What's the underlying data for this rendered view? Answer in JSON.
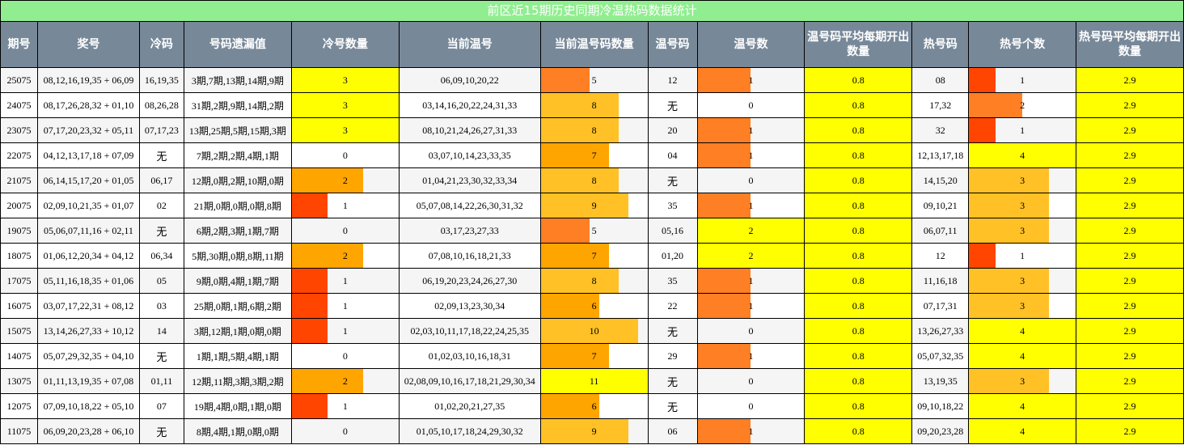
{
  "title": "前区近15期历史同期冷温热码数据统计",
  "headers": [
    "期号",
    "奖号",
    "冷码",
    "号码遗漏值",
    "冷号数量",
    "当前温号",
    "当前温号码数量",
    "温号码",
    "温号数",
    "温号码平均每期开出数量",
    "热号码",
    "热号个数",
    "热号码平均每期开出数量"
  ],
  "none_label": "无",
  "colors": {
    "title_bg": "#90ee90",
    "header_bg": "#778899",
    "yellow": "#ffff00",
    "bar_1": "#ff4500",
    "bar_2": "#ffa500",
    "bar_3": "#ffc125",
    "warm_bar": "#ff7f24"
  },
  "chart_data": {
    "type": "table",
    "scales": {
      "cold_count_max": 3,
      "warm_current_max": 11,
      "warm_count_max": 2,
      "hot_count_max": 4
    },
    "rows": [
      {
        "issue": "25075",
        "draw": "08,12,16,19,35 + 06,09",
        "cold_codes": "16,19,35",
        "miss": "3期,7期,13期,14期,9期",
        "cold_count": 3,
        "warm_current": "06,09,10,20,22",
        "warm_current_count": 5,
        "warm_codes": "12",
        "warm_count": 1,
        "warm_avg": "0.8",
        "hot_codes": "08",
        "hot_count": 1,
        "hot_avg": "2.9"
      },
      {
        "issue": "24075",
        "draw": "08,17,26,28,32 + 01,10",
        "cold_codes": "08,26,28",
        "miss": "31期,2期,9期,14期,2期",
        "cold_count": 3,
        "warm_current": "03,14,16,20,22,24,31,33",
        "warm_current_count": 8,
        "warm_codes": "无",
        "warm_count": 0,
        "warm_avg": "0.8",
        "hot_codes": "17,32",
        "hot_count": 2,
        "hot_avg": "2.9"
      },
      {
        "issue": "23075",
        "draw": "07,17,20,23,32 + 05,11",
        "cold_codes": "07,17,23",
        "miss": "13期,25期,5期,15期,3期",
        "cold_count": 3,
        "warm_current": "08,10,21,24,26,27,31,33",
        "warm_current_count": 8,
        "warm_codes": "20",
        "warm_count": 1,
        "warm_avg": "0.8",
        "hot_codes": "32",
        "hot_count": 1,
        "hot_avg": "2.9"
      },
      {
        "issue": "22075",
        "draw": "04,12,13,17,18 + 07,09",
        "cold_codes": "无",
        "miss": "7期,2期,2期,4期,1期",
        "cold_count": 0,
        "warm_current": "03,07,10,14,23,33,35",
        "warm_current_count": 7,
        "warm_codes": "04",
        "warm_count": 1,
        "warm_avg": "0.8",
        "hot_codes": "12,13,17,18",
        "hot_count": 4,
        "hot_avg": "2.9"
      },
      {
        "issue": "21075",
        "draw": "06,14,15,17,20 + 01,05",
        "cold_codes": "06,17",
        "miss": "12期,0期,2期,10期,0期",
        "cold_count": 2,
        "warm_current": "01,04,21,23,30,32,33,34",
        "warm_current_count": 8,
        "warm_codes": "无",
        "warm_count": 0,
        "warm_avg": "0.8",
        "hot_codes": "14,15,20",
        "hot_count": 3,
        "hot_avg": "2.9"
      },
      {
        "issue": "20075",
        "draw": "02,09,10,21,35 + 01,07",
        "cold_codes": "02",
        "miss": "21期,0期,0期,0期,8期",
        "cold_count": 1,
        "warm_current": "05,07,08,14,22,26,30,31,32",
        "warm_current_count": 9,
        "warm_codes": "35",
        "warm_count": 1,
        "warm_avg": "0.8",
        "hot_codes": "09,10,21",
        "hot_count": 3,
        "hot_avg": "2.9"
      },
      {
        "issue": "19075",
        "draw": "05,06,07,11,16 + 02,11",
        "cold_codes": "无",
        "miss": "6期,2期,3期,1期,7期",
        "cold_count": 0,
        "warm_current": "03,17,23,27,33",
        "warm_current_count": 5,
        "warm_codes": "05,16",
        "warm_count": 2,
        "warm_avg": "0.8",
        "hot_codes": "06,07,11",
        "hot_count": 3,
        "hot_avg": "2.9"
      },
      {
        "issue": "18075",
        "draw": "01,06,12,20,34 + 04,12",
        "cold_codes": "06,34",
        "miss": "5期,30期,0期,8期,11期",
        "cold_count": 2,
        "warm_current": "07,08,10,16,18,21,33",
        "warm_current_count": 7,
        "warm_codes": "01,20",
        "warm_count": 2,
        "warm_avg": "0.8",
        "hot_codes": "12",
        "hot_count": 1,
        "hot_avg": "2.9"
      },
      {
        "issue": "17075",
        "draw": "05,11,16,18,35 + 01,06",
        "cold_codes": "05",
        "miss": "9期,0期,4期,1期,7期",
        "cold_count": 1,
        "warm_current": "06,19,20,23,24,26,27,30",
        "warm_current_count": 8,
        "warm_codes": "35",
        "warm_count": 1,
        "warm_avg": "0.8",
        "hot_codes": "11,16,18",
        "hot_count": 3,
        "hot_avg": "2.9"
      },
      {
        "issue": "16075",
        "draw": "03,07,17,22,31 + 08,12",
        "cold_codes": "03",
        "miss": "25期,0期,1期,6期,2期",
        "cold_count": 1,
        "warm_current": "02,09,13,23,30,34",
        "warm_current_count": 6,
        "warm_codes": "22",
        "warm_count": 1,
        "warm_avg": "0.8",
        "hot_codes": "07,17,31",
        "hot_count": 3,
        "hot_avg": "2.9"
      },
      {
        "issue": "15075",
        "draw": "13,14,26,27,33 + 10,12",
        "cold_codes": "14",
        "miss": "3期,12期,1期,0期,0期",
        "cold_count": 1,
        "warm_current": "02,03,10,11,17,18,22,24,25,35",
        "warm_current_count": 10,
        "warm_codes": "无",
        "warm_count": 0,
        "warm_avg": "0.8",
        "hot_codes": "13,26,27,33",
        "hot_count": 4,
        "hot_avg": "2.9"
      },
      {
        "issue": "14075",
        "draw": "05,07,29,32,35 + 04,10",
        "cold_codes": "无",
        "miss": "1期,1期,5期,4期,1期",
        "cold_count": 0,
        "warm_current": "01,02,03,10,16,18,31",
        "warm_current_count": 7,
        "warm_codes": "29",
        "warm_count": 1,
        "warm_avg": "0.8",
        "hot_codes": "05,07,32,35",
        "hot_count": 4,
        "hot_avg": "2.9"
      },
      {
        "issue": "13075",
        "draw": "01,11,13,19,35 + 07,08",
        "cold_codes": "01,11",
        "miss": "12期,11期,3期,3期,2期",
        "cold_count": 2,
        "warm_current": "02,08,09,10,16,17,18,21,29,30,34",
        "warm_current_count": 11,
        "warm_codes": "无",
        "warm_count": 0,
        "warm_avg": "0.8",
        "hot_codes": "13,19,35",
        "hot_count": 3,
        "hot_avg": "2.9"
      },
      {
        "issue": "12075",
        "draw": "07,09,10,18,22 + 05,10",
        "cold_codes": "07",
        "miss": "19期,4期,0期,1期,0期",
        "cold_count": 1,
        "warm_current": "01,02,20,21,27,35",
        "warm_current_count": 6,
        "warm_codes": "无",
        "warm_count": 0,
        "warm_avg": "0.8",
        "hot_codes": "09,10,18,22",
        "hot_count": 4,
        "hot_avg": "2.9"
      },
      {
        "issue": "11075",
        "draw": "06,09,20,23,28 + 06,10",
        "cold_codes": "无",
        "miss": "8期,4期,1期,0期,0期",
        "cold_count": 0,
        "warm_current": "01,05,10,17,18,24,29,30,32",
        "warm_current_count": 9,
        "warm_codes": "06",
        "warm_count": 1,
        "warm_avg": "0.8",
        "hot_codes": "09,20,23,28",
        "hot_count": 4,
        "hot_avg": "2.9"
      }
    ]
  }
}
